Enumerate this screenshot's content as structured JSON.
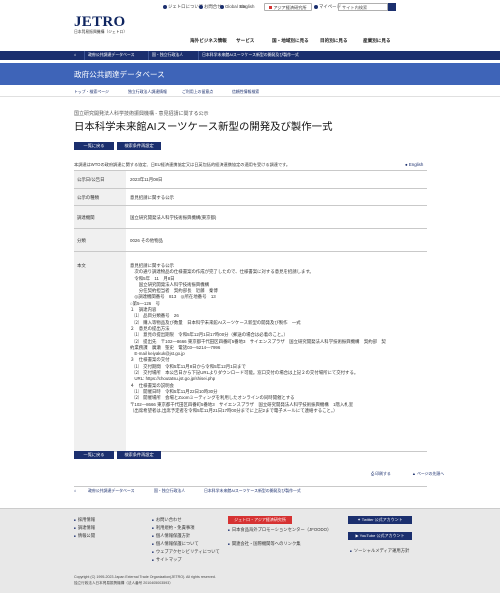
{
  "util": {
    "links": [
      "ジェトロについて",
      "お問合せ",
      "Global Site",
      "JETRO Global",
      "English"
    ],
    "red_button": "アジア経済研究所",
    "mypage": "マイページ",
    "search_placeholder": "サイト内検索"
  },
  "logo": {
    "name": "JETRO",
    "sub": "日本貿易振興機構（ジェトロ）"
  },
  "nav": [
    "海外ビジネス情報",
    "サービス",
    "国・地域別に見る",
    "目的別に見る",
    "産業別に見る"
  ],
  "bluebar": [
    "ホーム",
    "政府公共調達データベース",
    "国・独立行政法人",
    "日本科学未来館AIスーツケース新型の開発及び製作一式"
  ],
  "band_title": "政府公共調達データベース",
  "subnav": [
    "トップ・検索ページ",
    "独立行政法人調達情報",
    "ご利用上の留意点",
    "信頼性情報検索"
  ],
  "page": {
    "agency": "国立研究開発法人科学技術振興機構 - 意見招請に関する公示",
    "title": "日本科学未来館AIスーツケース新型の開発及び製作一式",
    "btn_back": "一覧に戻る",
    "btn_new": "検索条件再設定",
    "note": "本調達はWTOの政府調達に関する協定、日EU経済連携協定又は日英包括的経済連携協定の適用を受ける調達です。",
    "english": "English"
  },
  "table": {
    "rows": [
      {
        "th": "公示日/公告日",
        "td": "2023年11月08日"
      },
      {
        "th": "公示の種類",
        "td": "意見招請に関する公示"
      },
      {
        "th": "調達機関",
        "td": "国立研究開発法人科学技術振興機構(東京都)"
      },
      {
        "th": "分類",
        "td": "0026 その他物品"
      }
    ],
    "body_label": "本文",
    "body_lines": [
      "意見招請に関する公示",
      "　次の通り調達物品の仕様書案の作成が完了したので、仕様書案に対する意見を招請します。",
      "　令和5年　11　月8日",
      "　　国立研究開発法人科学技術振興機構",
      "　　分任契約担当者　契約部長　近藤　秦博",
      "　◎調達機関番号　813　◎所在地番号　13",
      "○第5―126　号",
      "１　調達内容",
      "　⑴　品目分類番号　26",
      "　⑵　購入等物品及び数量　日本科学未来館AIスーツケース新型の開発及び製作　一式",
      "２　意見の提出方法",
      "　⑴　意見の提出期限　令和5年12月1日17時00分（郵送の場合は必着のこと。）",
      "　⑵　提出先　〒102―8666 東京都千代田区四番町5番地3　サイエンスプラザ　国立研究開発法人科学技術振興機構　契約部　契",
      "約業務課　廣瀬　聖史　電話03―5214―7996",
      "　E-mail keiyakuk@jst.go.jp",
      "３　仕様書案の交付",
      "　⑴　交付期間　令和5年11月8日から令和5年12月1日まで",
      "　⑵　交付場所　本公告日から下記URLよりダウンロード可能。窓口交付の場合は上記２の交付場所にて交付する。",
      "　URL: https://choutatsu.jst.go.jp/shisei.php",
      "４　仕様書案の説明会",
      "　⑴　開催日時　令和5年11月22日10時30分",
      "　⑵　開催場所　会場とZoomミーティングを利用したオンラインの同時開催とする",
      "〒102―8666 東京都千代田区四番町5番地3　サイエンスプラザ　国立研究開発法人科学技術振興機構　1階入札室",
      "（出席希望者は,出席予定者を令和5年11月21日17時00分までに上記2まで電子メールにて連絡すること。）"
    ]
  },
  "bottom": {
    "print": "印刷する",
    "top": "ページの先頭へ",
    "crumbs": [
      "ホーム",
      "政府公共調達データベース",
      "国・独立行政法人",
      "日本科学未来館AIスーツケース新型の開発及び製作一式"
    ]
  },
  "footer": {
    "col1": [
      "採用情報",
      "調達情報",
      "情報公開"
    ],
    "col2": [
      "お問い合わせ",
      "利用規約・免責事項",
      "個人情報保護方針",
      "個人情報保護について",
      "ウェブアクセシビリティについて",
      "サイトマップ"
    ],
    "col3": [
      "ジェトロ・アジア経済研究所",
      "日本食品海外プロモーションセンター（JFOODO）",
      "関連会社・国際機関等へのリンク集"
    ],
    "col4": [
      "Twitter 公式アカウント",
      "YouTube 公式アカウント",
      "ソーシャルメディア運用方針"
    ],
    "copyright": "Copyright (C) 1995-2023 Japan External Trade Organization(JETRO). All rights reserved.",
    "corp": "独立行政法人日本貿易振興機構（法人番号 2010405003593）"
  }
}
